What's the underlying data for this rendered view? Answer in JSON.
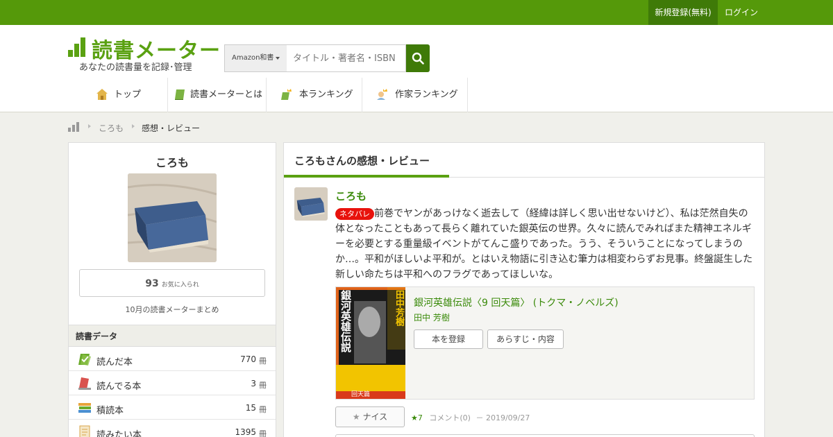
{
  "topbar": {
    "register": "新規登録(無料)",
    "login": "ログイン"
  },
  "logo": {
    "name": "読書メーター",
    "tagline": "あなたの読書量を記録･管理"
  },
  "search": {
    "category": "Amazon和書",
    "placeholder": "タイトル・著者名・ISBN"
  },
  "nav": [
    {
      "label": "トップ",
      "icon": "house-icon"
    },
    {
      "label": "読書メーターとは",
      "icon": "book-icon"
    },
    {
      "label": "本ランキング",
      "icon": "book-ranking-icon"
    },
    {
      "label": "作家ランキング",
      "icon": "author-ranking-icon"
    }
  ],
  "breadcrumb": [
    "ころも",
    "感想・レビュー"
  ],
  "user": {
    "name": "ころも",
    "favorites_count": "93",
    "favorites_label": "お気に入られ",
    "summary_link": "10月の読書メーターまとめ"
  },
  "reading_data": {
    "heading": "読書データ",
    "rows": [
      {
        "label": "読んだ本",
        "count": "770",
        "unit": "冊",
        "icon": "read-books-icon"
      },
      {
        "label": "読んでる本",
        "count": "3",
        "unit": "冊",
        "icon": "reading-books-icon"
      },
      {
        "label": "積読本",
        "count": "15",
        "unit": "冊",
        "icon": "stacked-books-icon"
      },
      {
        "label": "読みたい本",
        "count": "1395",
        "unit": "冊",
        "icon": "wishlist-icon"
      }
    ]
  },
  "main": {
    "heading": "ころもさんの感想・レビュー",
    "review": {
      "user": "ころも",
      "spoiler_badge": "ネタバレ",
      "text": "前巻でヤンがあっけなく逝去して（経緯は詳しく思い出せないけど）、私は茫然自失の体となったこともあって長らく離れていた銀英伝の世界。久々に読んでみればまた精神エネルギーを必要とする重量級イベントがてんこ盛りであった。うう、そういうことになってしまうのか…。平和がほしいよ平和が。とはいえ物語に引き込む筆力は相変わらずお見事。終盤誕生した新しい命たちは平和へのフラグであってほしいな。",
      "book": {
        "title": "銀河英雄伝説〈9 回天篇〉 (トクマ・ノベルズ)",
        "author": "田中 芳樹",
        "register_button": "本を登録",
        "synopsis_button": "あらすじ・内容",
        "cover_title": "銀河英雄伝説",
        "cover_author": "田中芳樹",
        "cover_label": "回天篇"
      },
      "nice_button": "ナイス",
      "stars": "★7",
      "comments": "コメント(0)",
      "date": "－ 2019/09/27"
    }
  },
  "colors": {
    "brand": "#55990a",
    "brand_dark": "#3f7a08",
    "link": "#3a8a0a",
    "spoiler": "#e8120c"
  }
}
